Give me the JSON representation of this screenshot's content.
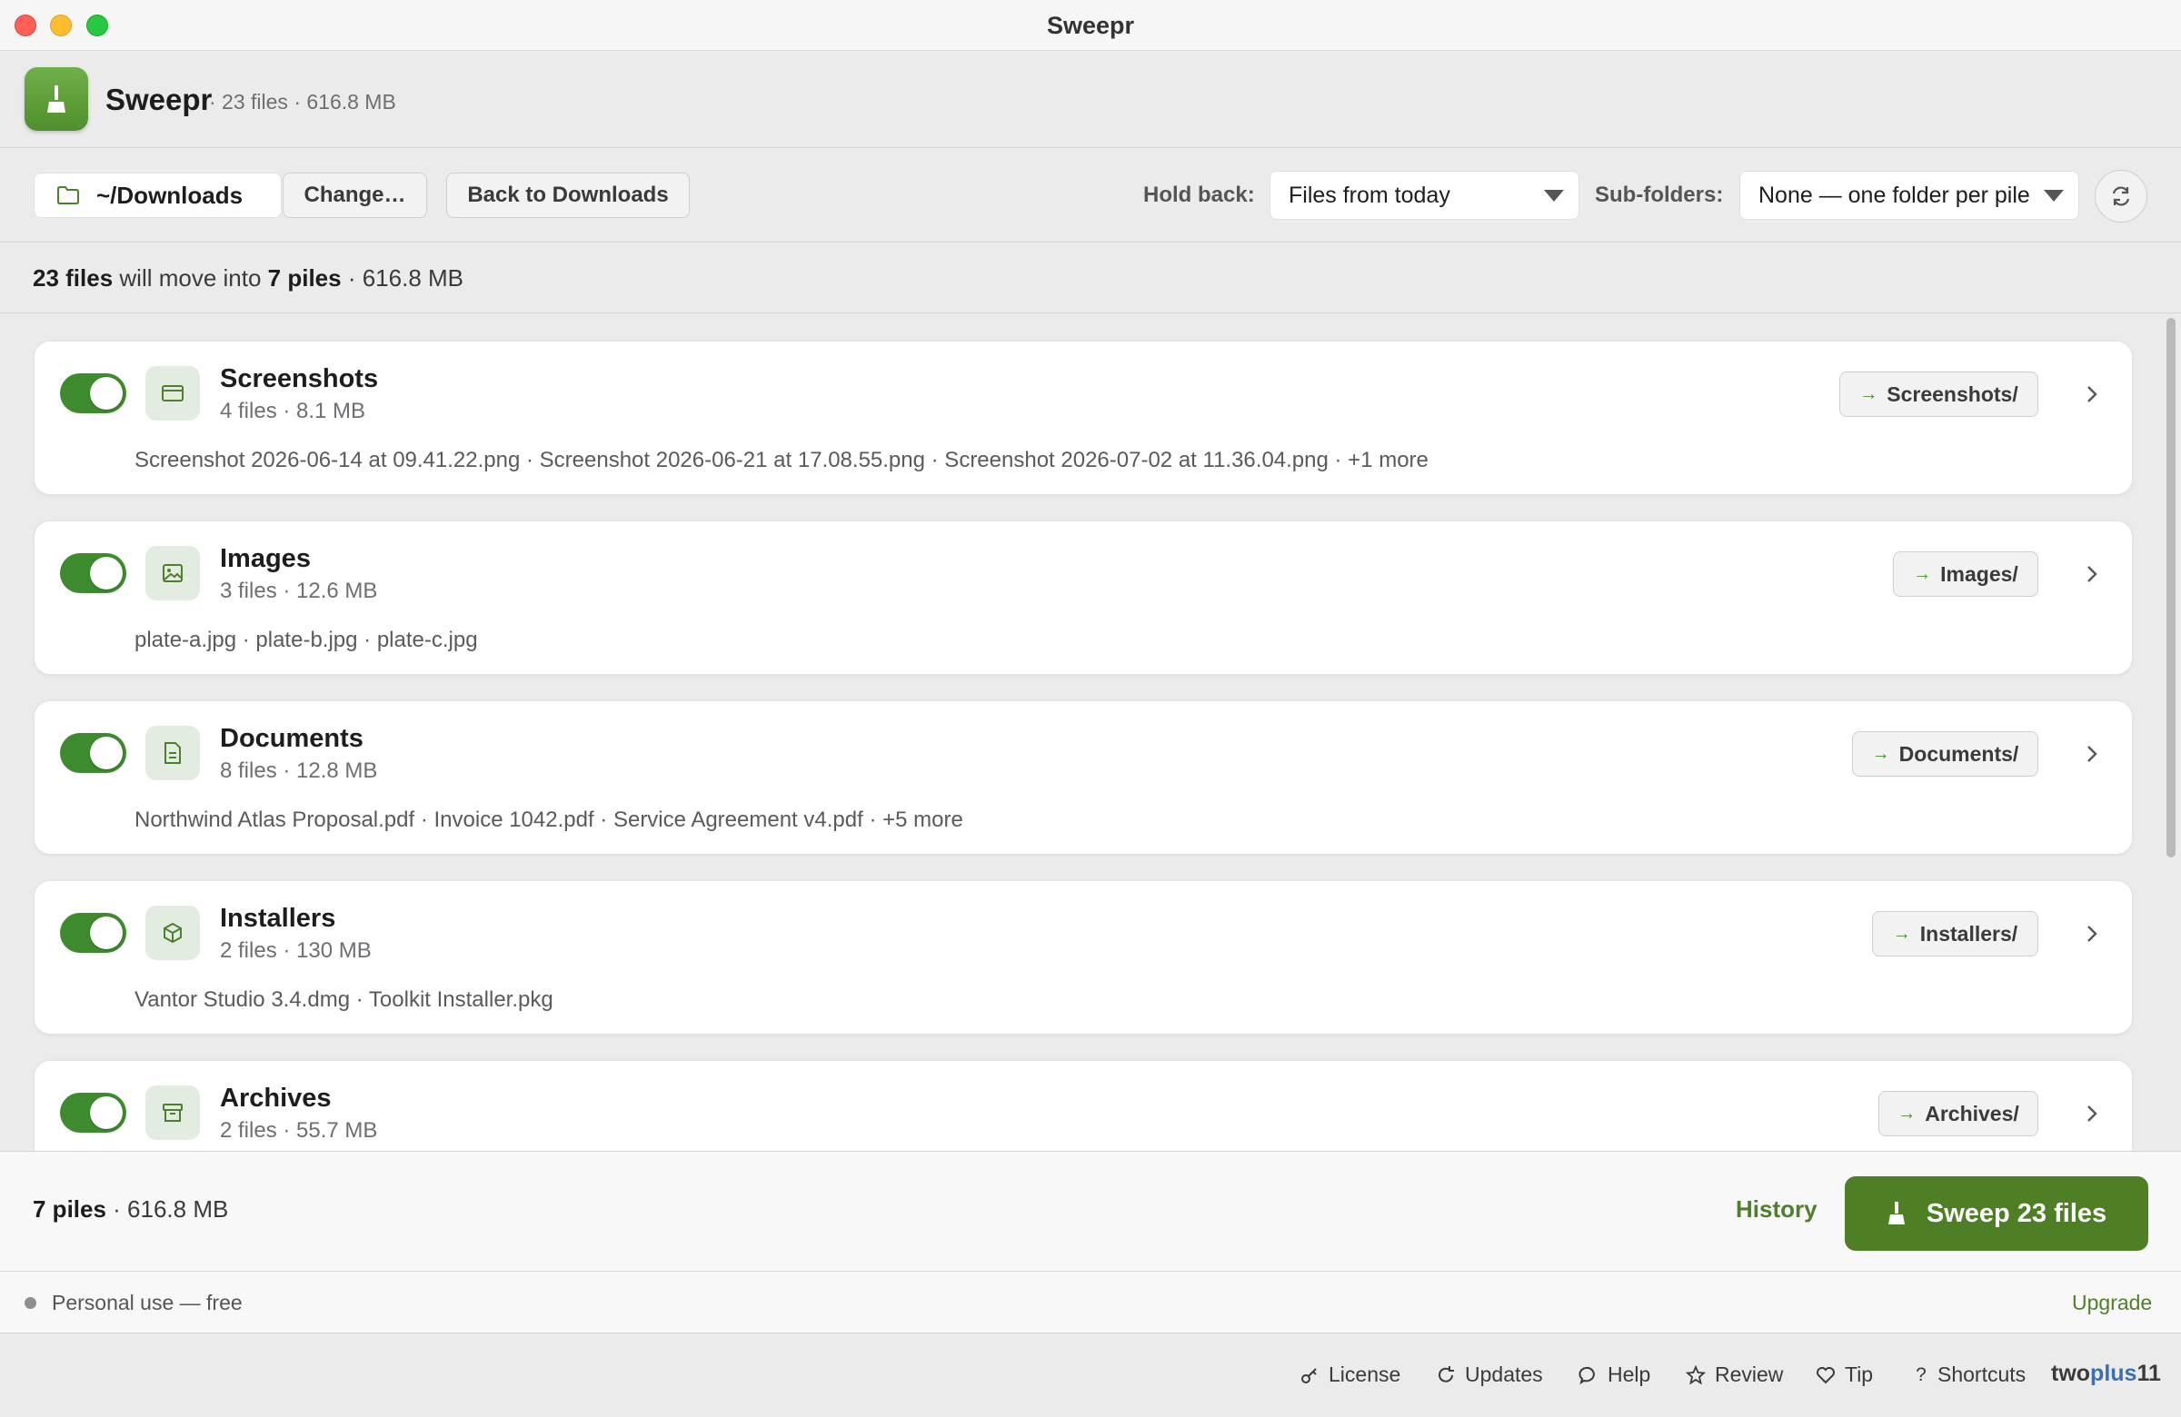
{
  "window": {
    "title": "Sweepr"
  },
  "header": {
    "app_name": "Sweepr",
    "meta": "· 23 files · 616.8 MB"
  },
  "toolbar": {
    "path_label": "~/Downloads",
    "change_label": "Change…",
    "back_label": "Back to Downloads",
    "hold_back_label": "Hold back:",
    "hold_back_value": "Files from today",
    "subfolders_label": "Sub-folders:",
    "subfolders_value": "None — one folder per pile"
  },
  "summary": {
    "files": "23 files",
    "middle": " will move into ",
    "piles": "7 piles",
    "size": " · 616.8 MB"
  },
  "piles": [
    {
      "name": "Screenshots",
      "meta": "4 files · 8.1 MB",
      "files": "Screenshot 2026-06-14 at 09.41.22.png · Screenshot 2026-06-21 at 17.08.55.png · Screenshot 2026-07-02 at 11.36.04.png · +1 more",
      "dest": "Screenshots/",
      "enabled": true,
      "icon": "window-icon"
    },
    {
      "name": "Images",
      "meta": "3 files · 12.6 MB",
      "files": "plate-a.jpg · plate-b.jpg · plate-c.jpg",
      "dest": "Images/",
      "enabled": true,
      "icon": "image-icon"
    },
    {
      "name": "Documents",
      "meta": "8 files · 12.8 MB",
      "files": "Northwind Atlas Proposal.pdf · Invoice 1042.pdf · Service Agreement v4.pdf · +5 more",
      "dest": "Documents/",
      "enabled": true,
      "icon": "document-icon"
    },
    {
      "name": "Installers",
      "meta": "2 files · 130 MB",
      "files": "Vantor Studio 3.4.dmg · Toolkit Installer.pkg",
      "dest": "Installers/",
      "enabled": true,
      "icon": "package-icon"
    },
    {
      "name": "Archives",
      "meta": "2 files · 55.7 MB",
      "files": "",
      "dest": "Archives/",
      "enabled": true,
      "icon": "archive-icon"
    }
  ],
  "footer": {
    "piles": "7 piles",
    "size": " · 616.8 MB",
    "history_label": "History",
    "sweep_label": "Sweep 23 files"
  },
  "license": {
    "status": "Personal use — free",
    "upgrade_label": "Upgrade"
  },
  "links": {
    "license": "License",
    "updates": "Updates",
    "help": "Help",
    "review": "Review",
    "tip": "Tip",
    "shortcuts": "Shortcuts"
  },
  "brand": {
    "part1": "two",
    "part2": "plus",
    "part3": "11"
  },
  "colors": {
    "accent": "#4f7f24",
    "toggle_on": "#3e8a2e",
    "icon_bg": "#e3ece0"
  }
}
